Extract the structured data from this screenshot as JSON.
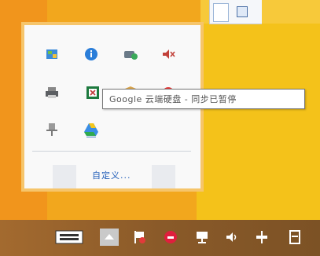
{
  "tray_overflow": {
    "customize_label": "自定义...",
    "icons": [
      {
        "name": "network-map-icon"
      },
      {
        "name": "info-icon"
      },
      {
        "name": "sync-chat-icon"
      },
      {
        "name": "speaker-muted-icon"
      },
      {
        "name": "printer-icon"
      },
      {
        "name": "excel-sheet-icon"
      },
      {
        "name": "shield-icon"
      },
      {
        "name": "red-dot-icon"
      },
      {
        "name": "pin-icon"
      },
      {
        "name": "google-drive-icon"
      }
    ]
  },
  "tooltip": {
    "text": "Google 云端硬盘 - 同步已暂停"
  },
  "taskbar": {
    "icons": [
      "keyboard-icon",
      "show-hidden-arrow-icon",
      "flag-icon",
      "stop-icon",
      "monitor-icon",
      "volume-icon",
      "network-icon",
      "action-center-icon"
    ]
  },
  "colors": {
    "desktop": "#f2a71d",
    "panel_border": "#f6c56b",
    "taskbar": "#8b5e2a",
    "link": "#1f5cb8"
  }
}
